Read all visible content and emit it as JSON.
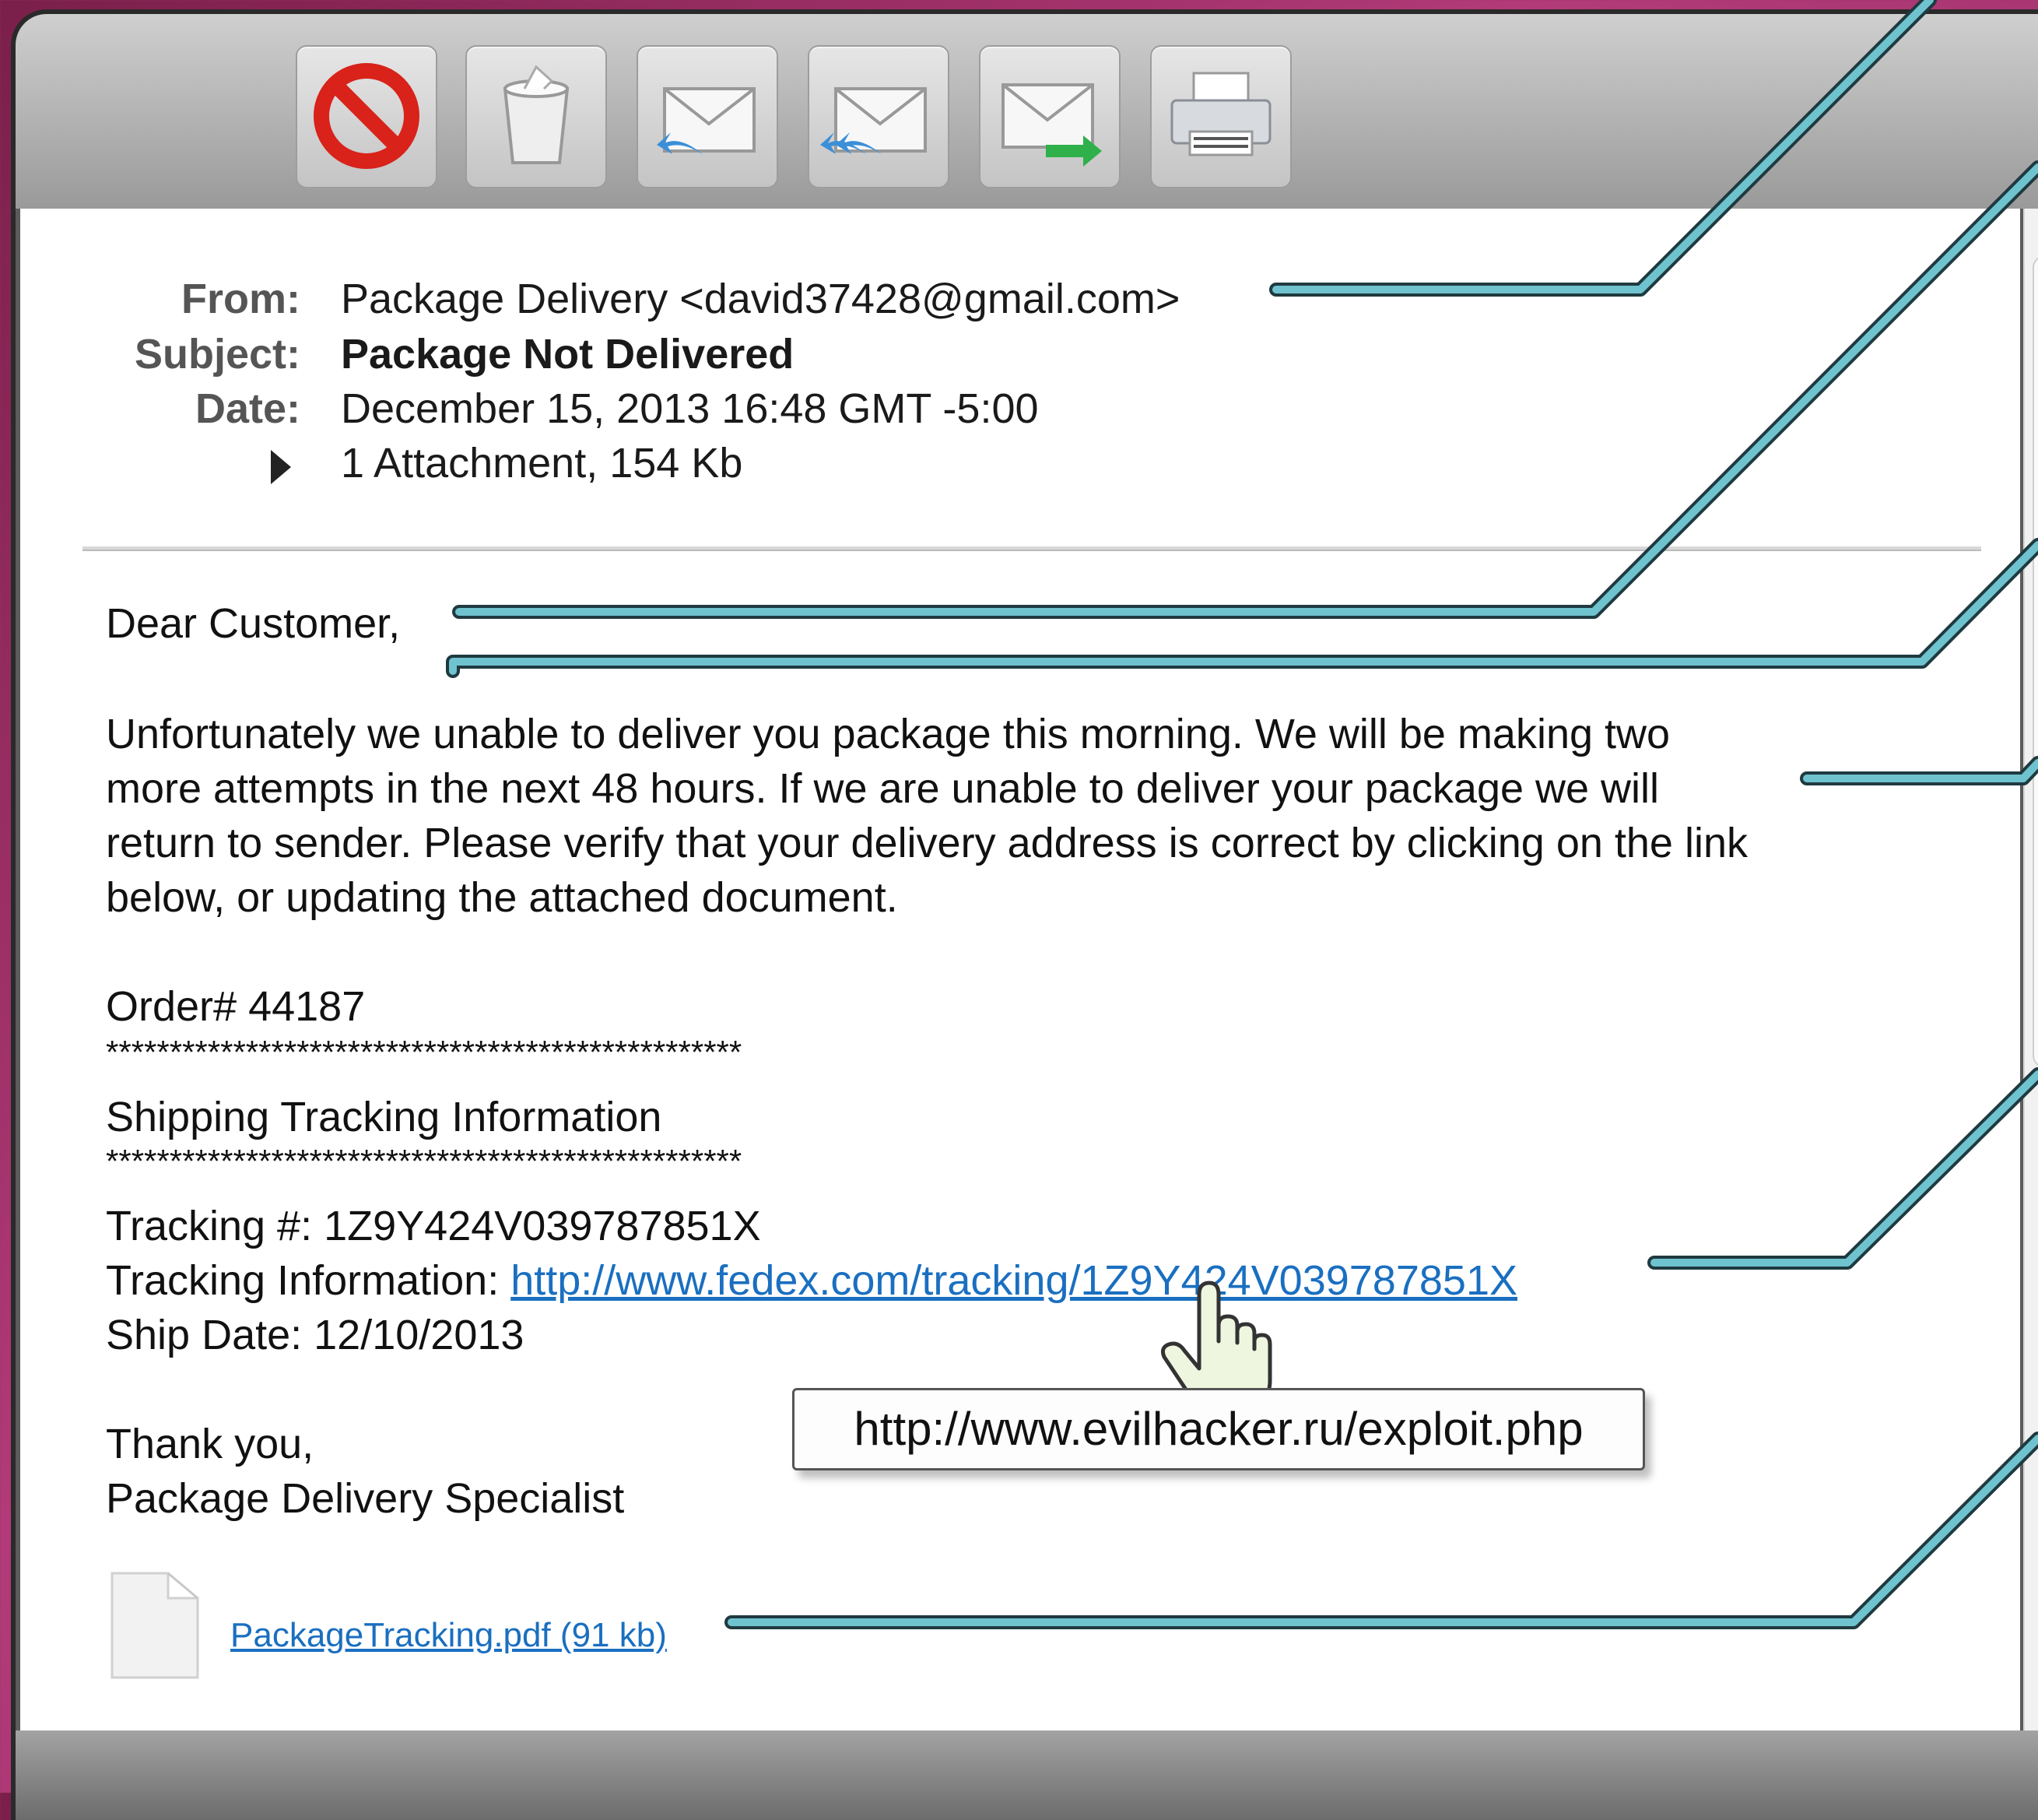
{
  "email": {
    "from_label": "From:",
    "from_value": "Package Delivery <david37428@gmail.com>",
    "subject_label": "Subject:",
    "subject_value": "Package Not Delivered",
    "date_label": "Date:",
    "date_value": "December 15, 2013 16:48 GMT -5:00",
    "attachment_summary": "1 Attachment, 154 Kb"
  },
  "body": {
    "greeting": "Dear Customer,",
    "paragraph_lines": [
      "Unfortunately we unable to deliver you package this morning. We will be making two",
      "more attempts in the next 48 hours. If we are unable to deliver your package we will",
      "return to sender. Please verify that your delivery address is correct by clicking on the link",
      "below, or updating the attached document."
    ],
    "order": "Order# 44187",
    "stars": "**************************************************",
    "shipping_heading": "Shipping Tracking Information",
    "tracking_number": "Tracking #: 1Z9Y424V039787851X",
    "tracking_info_label": "Tracking Information: ",
    "tracking_link": "http://www.fedex.com/tracking/1Z9Y424V039787851X",
    "ship_date": "Ship Date: 12/10/2013",
    "thanks": "Thank you,",
    "signature": "Package Delivery Specialist",
    "attachment_link": "PackageTracking.pdf (91 kb)"
  },
  "hover_tooltip": "http://www.evilhacker.ru/exploit.php",
  "toolbar_icons": [
    "block-icon",
    "trash-icon",
    "reply-icon",
    "reply-all-icon",
    "forward-icon",
    "print-icon"
  ],
  "colors": {
    "callout_line": "#6fc3cf",
    "link": "#1a6fc0"
  }
}
